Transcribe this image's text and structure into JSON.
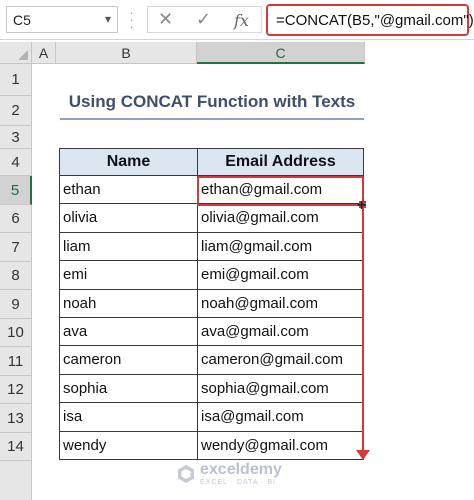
{
  "formula_bar": {
    "name_box": "C5",
    "cancel_glyph": "✕",
    "enter_glyph": "✓",
    "fx_label": "fx",
    "formula": "=CONCAT(B5,\"@gmail.com\")"
  },
  "sheet": {
    "columns": [
      "A",
      "B",
      "C"
    ],
    "rows": [
      "1",
      "2",
      "3",
      "4",
      "5",
      "6",
      "7",
      "8",
      "9",
      "10",
      "11",
      "12",
      "13",
      "14"
    ],
    "selected_cell": "C5",
    "title": "Using CONCAT Function with Texts",
    "table": {
      "headers": [
        "Name",
        "Email Address"
      ],
      "rows": [
        [
          "ethan",
          "ethan@gmail.com"
        ],
        [
          "olivia",
          "olivia@gmail.com"
        ],
        [
          "liam",
          "liam@gmail.com"
        ],
        [
          "emi",
          "emi@gmail.com"
        ],
        [
          "noah",
          "noah@gmail.com"
        ],
        [
          "ava",
          "ava@gmail.com"
        ],
        [
          "cameron",
          "cameron@gmail.com"
        ],
        [
          "sophia",
          "sophia@gmail.com"
        ],
        [
          "isa",
          "isa@gmail.com"
        ],
        [
          "wendy",
          "wendy@gmail.com"
        ]
      ]
    }
  },
  "watermark": {
    "name": "exceldemy",
    "tagline": "EXCEL · DATA · BI"
  },
  "colors": {
    "highlight": "#d43a3a",
    "header_fill": "#dce6f1",
    "title_text": "#3d4f6a",
    "excel_green": "#217346"
  }
}
